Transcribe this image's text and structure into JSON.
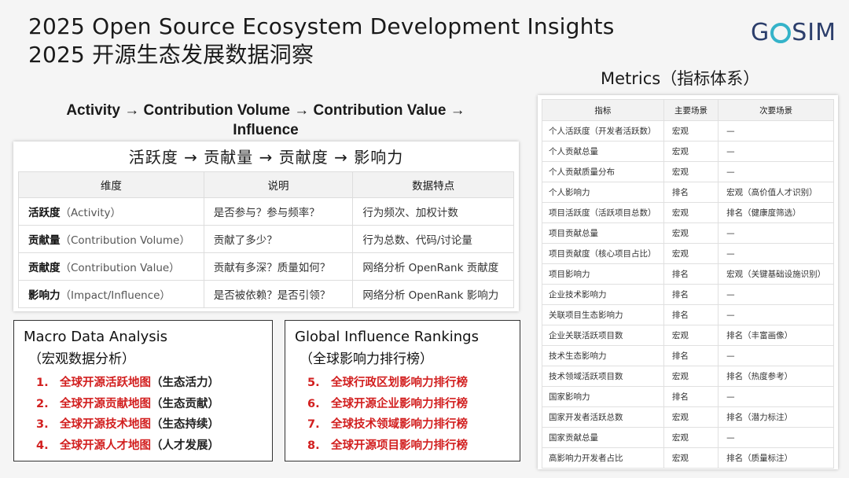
{
  "header": {
    "title_en": "2025 Open Source Ecosystem Development Insights",
    "title_zh": "2025 开源生态发展数据洞察",
    "logo_left": "G",
    "logo_right": "SIM"
  },
  "flow": {
    "line1": "Activity → Contribution Volume → Contribution Value →",
    "line2": "Influence"
  },
  "dimensions": {
    "heading": "活跃度 → 贡献量 → 贡献度 → 影响力",
    "columns": [
      "维度",
      "说明",
      "数据特点"
    ],
    "rows": [
      {
        "name": "活跃度",
        "en": "（Activity）",
        "desc": "是否参与？参与频率？",
        "feature": "行为频次、加权计数"
      },
      {
        "name": "贡献量",
        "en": "（Contribution Volume）",
        "desc": "贡献了多少？",
        "feature": "行为总数、代码/讨论量"
      },
      {
        "name": "贡献度",
        "en": "（Contribution Value）",
        "desc": "贡献有多深？质量如何？",
        "feature": "网络分析 OpenRank 贡献度"
      },
      {
        "name": "影响力",
        "en": "（Impact/Influence）",
        "desc": "是否被依赖？是否引领？",
        "feature": "网络分析 OpenRank 影响力"
      }
    ]
  },
  "macro": {
    "title": "Macro Data Analysis",
    "subtitle": "（宏观数据分析）",
    "items": [
      {
        "num": "1.",
        "label": "全球开源活跃地图",
        "note": "（生态活力）"
      },
      {
        "num": "2.",
        "label": "全球开源贡献地图",
        "note": "（生态贡献）"
      },
      {
        "num": "3.",
        "label": "全球开源技术地图",
        "note": "（生态持续）"
      },
      {
        "num": "4.",
        "label": "全球开源人才地图",
        "note": "（人才发展）"
      }
    ]
  },
  "global": {
    "title": "Global Influence Rankings",
    "subtitle": "（全球影响力排行榜）",
    "items": [
      {
        "num": "5.",
        "label": "全球行政区划影响力排行榜"
      },
      {
        "num": "6.",
        "label": "全球开源企业影响力排行榜"
      },
      {
        "num": "7.",
        "label": "全球技术领域影响力排行榜"
      },
      {
        "num": "8.",
        "label": "全球开源项目影响力排行榜"
      }
    ]
  },
  "metrics": {
    "title": "Metrics（指标体系）",
    "columns": [
      "指标",
      "主要场景",
      "次要场景"
    ],
    "rows": [
      [
        "个人活跃度（开发者活跃数）",
        "宏观",
        "—"
      ],
      [
        "个人贡献总量",
        "宏观",
        "—"
      ],
      [
        "个人贡献质量分布",
        "宏观",
        "—"
      ],
      [
        "个人影响力",
        "排名",
        "宏观（高价值人才识别）"
      ],
      [
        "项目活跃度（活跃项目总数）",
        "宏观",
        "排名（健康度筛选）"
      ],
      [
        "项目贡献总量",
        "宏观",
        "—"
      ],
      [
        "项目贡献度（核心项目占比）",
        "宏观",
        "—"
      ],
      [
        "项目影响力",
        "排名",
        "宏观（关键基础设施识别）"
      ],
      [
        "企业技术影响力",
        "排名",
        "—"
      ],
      [
        "关联项目生态影响力",
        "排名",
        "—"
      ],
      [
        "企业关联活跃项目数",
        "宏观",
        "排名（丰富画像）"
      ],
      [
        "技术生态影响力",
        "排名",
        "—"
      ],
      [
        "技术领域活跃项目数",
        "宏观",
        "排名（热度参考）"
      ],
      [
        "国家影响力",
        "排名",
        "—"
      ],
      [
        "国家开发者活跃总数",
        "宏观",
        "排名（潜力标注）"
      ],
      [
        "国家贡献总量",
        "宏观",
        "—"
      ],
      [
        "高影响力开发者占比",
        "宏观",
        "排名（质量标注）"
      ]
    ]
  },
  "colors": {
    "accent_red": "#d21f1f",
    "logo_navy": "#2c3e6b",
    "logo_teal": "#35b3c9"
  }
}
